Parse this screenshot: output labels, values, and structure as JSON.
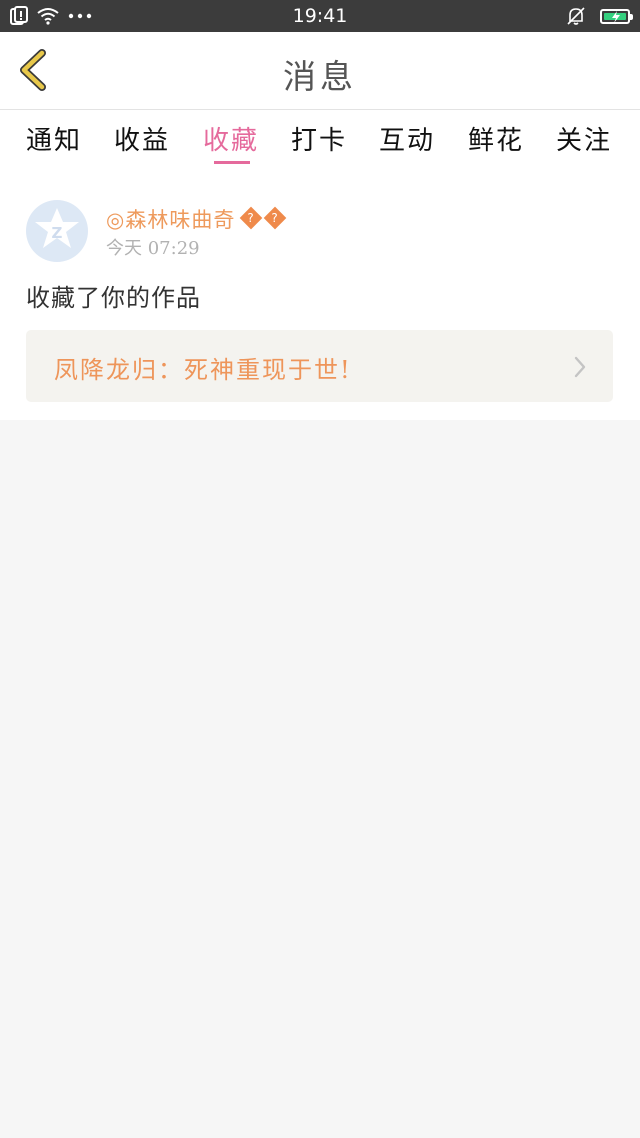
{
  "status_bar": {
    "time": "19:41",
    "battery_color": "#35d07f"
  },
  "navbar": {
    "title": "消息",
    "back_icon": "chevron-left-icon",
    "back_color": "#e8c84a"
  },
  "tabs": {
    "items": [
      {
        "label": "通知",
        "active": false
      },
      {
        "label": "收益",
        "active": false
      },
      {
        "label": "收藏",
        "active": true
      },
      {
        "label": "打卡",
        "active": false
      },
      {
        "label": "互动",
        "active": false
      },
      {
        "label": "鲜花",
        "active": false
      },
      {
        "label": "关注",
        "active": false
      }
    ],
    "active_color": "#e56a9c"
  },
  "message": {
    "avatar_icon": "default-avatar-icon",
    "username": "◎森林味曲奇",
    "username_badges": [
      "?",
      "?"
    ],
    "time": "今天 07:29",
    "action": "收藏了你的作品",
    "work_title": "凤降龙归：死神重现于世!",
    "accent_color": "#ee9a5c"
  }
}
